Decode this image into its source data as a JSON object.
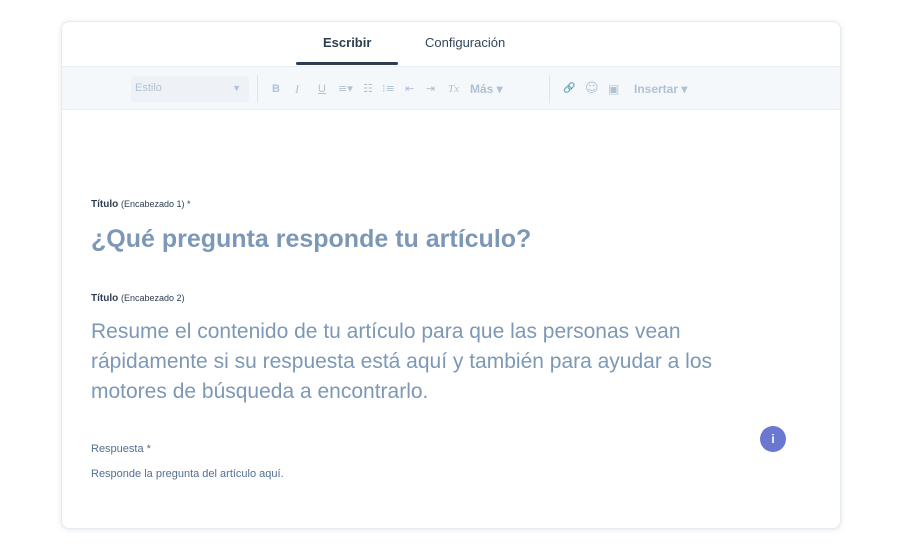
{
  "tabs": [
    {
      "label": "Escribir",
      "active": true
    },
    {
      "label": "Configuración",
      "active": false
    }
  ],
  "toolbar": {
    "style_select": {
      "value": "Estilo"
    },
    "buttons": {
      "bold": "B",
      "italic": "I",
      "underline": "U",
      "align": "≡▾",
      "bullet_list": "☷",
      "numbered_list": "⁝≡",
      "outdent": "⇤",
      "indent": "⇥",
      "clear_format": "Tx",
      "more": "Más ▾",
      "link": "🔗",
      "emoji": "☺",
      "image": "▣",
      "insert": "Insertar ▾"
    }
  },
  "content": {
    "title1_label": "Título",
    "title1_hint": "(Encabezado 1) *",
    "title1_placeholder": "¿Qué pregunta responde tu artículo?",
    "title2_label": "Título",
    "title2_hint": "(Encabezado 2)",
    "title2_placeholder": "Resume el contenido de tu artículo para que las personas vean rápidamente si su respuesta está aquí y también para ayudar a los motores de búsqueda a encontrarlo.",
    "answer_label": "Respuesta *",
    "answer_placeholder": "Responde la pregunta del artículo aquí."
  },
  "info_badge": "i",
  "colors": {
    "accent": "#2d3e50",
    "placeholder": "#7c98b6",
    "badge": "#6a78d1",
    "toolbar_bg": "#f5f8fa"
  }
}
